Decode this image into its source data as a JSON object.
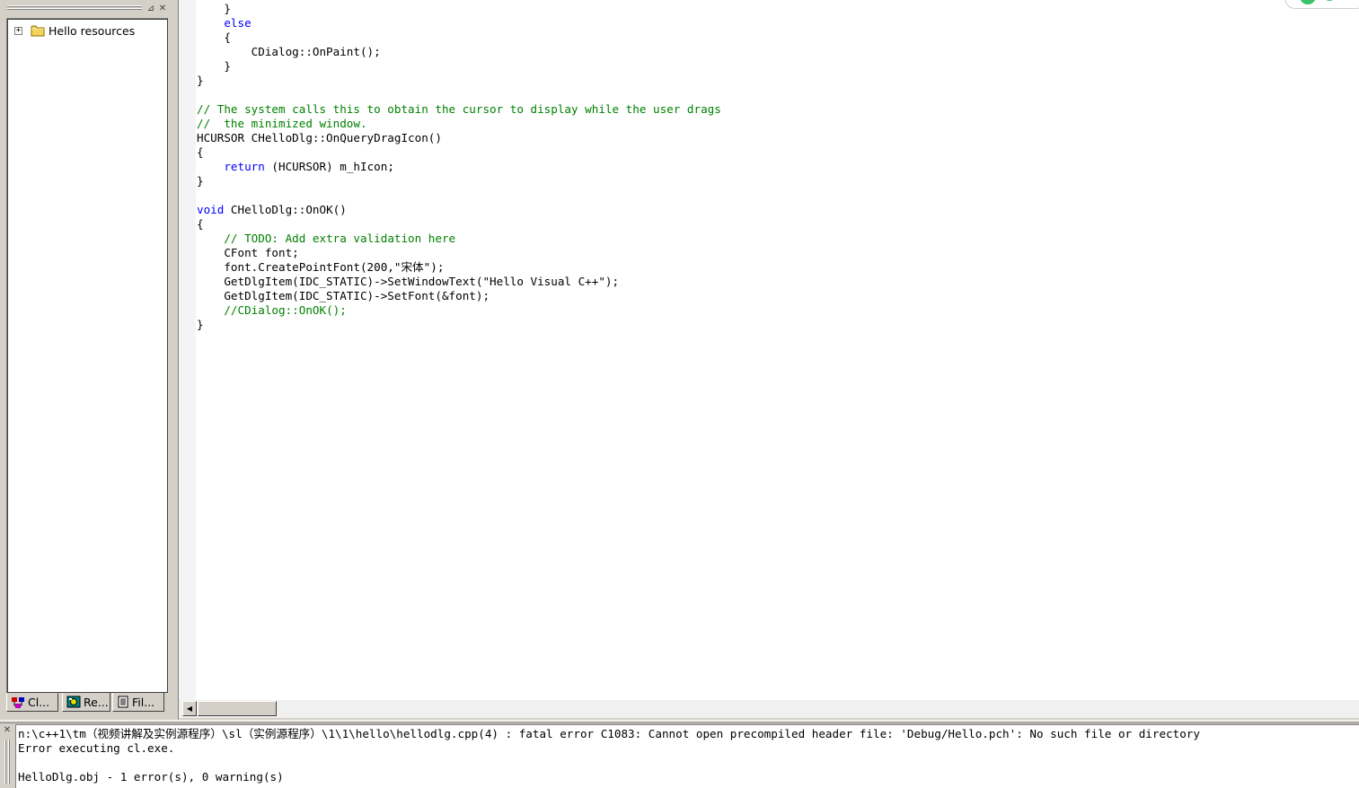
{
  "workspace": {
    "tree_root_label": "Hello resources",
    "tree_expander": "+",
    "max_glyph": "⊿",
    "close_glyph": "✕",
    "tabs": [
      {
        "label": "Cl...",
        "icon": "class-view-icon"
      },
      {
        "label": "Re...",
        "icon": "resource-view-icon"
      },
      {
        "label": "Fil...",
        "icon": "file-view-icon"
      }
    ]
  },
  "editor": {
    "lines": [
      [
        {
          "t": "    }",
          "c": "n"
        }
      ],
      [
        {
          "t": "    ",
          "c": "n"
        },
        {
          "t": "else",
          "c": "kw"
        }
      ],
      [
        {
          "t": "    {",
          "c": "n"
        }
      ],
      [
        {
          "t": "        CDialog::OnPaint();",
          "c": "n"
        }
      ],
      [
        {
          "t": "    }",
          "c": "n"
        }
      ],
      [
        {
          "t": "}",
          "c": "n"
        }
      ],
      [
        {
          "t": "",
          "c": "n"
        }
      ],
      [
        {
          "t": "// The system calls this to obtain the cursor to display while the user drags",
          "c": "cm"
        }
      ],
      [
        {
          "t": "//  the minimized window.",
          "c": "cm"
        }
      ],
      [
        {
          "t": "HCURSOR CHelloDlg::OnQueryDragIcon()",
          "c": "n"
        }
      ],
      [
        {
          "t": "{",
          "c": "n"
        }
      ],
      [
        {
          "t": "    ",
          "c": "n"
        },
        {
          "t": "return",
          "c": "kw"
        },
        {
          "t": " (HCURSOR) m_hIcon;",
          "c": "n"
        }
      ],
      [
        {
          "t": "}",
          "c": "n"
        }
      ],
      [
        {
          "t": "",
          "c": "n"
        }
      ],
      [
        {
          "t": "void",
          "c": "kw"
        },
        {
          "t": " CHelloDlg::OnOK()",
          "c": "n"
        }
      ],
      [
        {
          "t": "{",
          "c": "n"
        }
      ],
      [
        {
          "t": "    ",
          "c": "n"
        },
        {
          "t": "// TODO: Add extra validation here",
          "c": "cm"
        }
      ],
      [
        {
          "t": "    CFont font;",
          "c": "n"
        }
      ],
      [
        {
          "t": "    font.CreatePointFont(200,\"宋体\");",
          "c": "n"
        }
      ],
      [
        {
          "t": "    GetDlgItem(IDC_STATIC)->SetWindowText(\"Hello Visual C++\");",
          "c": "n"
        }
      ],
      [
        {
          "t": "    GetDlgItem(IDC_STATIC)->SetFont(&font);",
          "c": "n"
        }
      ],
      [
        {
          "t": "    ",
          "c": "n"
        },
        {
          "t": "//CDialog::OnOK();",
          "c": "cm"
        }
      ],
      [
        {
          "t": "}",
          "c": "n"
        }
      ]
    ],
    "scroll_left_glyph": "◀"
  },
  "output": {
    "close_glyph": "✕",
    "lines": [
      "n:\\c++1\\tm（视频讲解及实例源程序）\\sl（实例源程序）\\1\\1\\hello\\hellodlg.cpp(4) : fatal error C1083: Cannot open precompiled header file: 'Debug/Hello.pch': No such file or directory",
      "Error executing cl.exe.",
      "",
      "HelloDlg.obj - 1 error(s), 0 warning(s)"
    ]
  },
  "colors": {
    "keyword": "#0000ff",
    "comment": "#008000",
    "chrome": "#d4d0c8"
  }
}
